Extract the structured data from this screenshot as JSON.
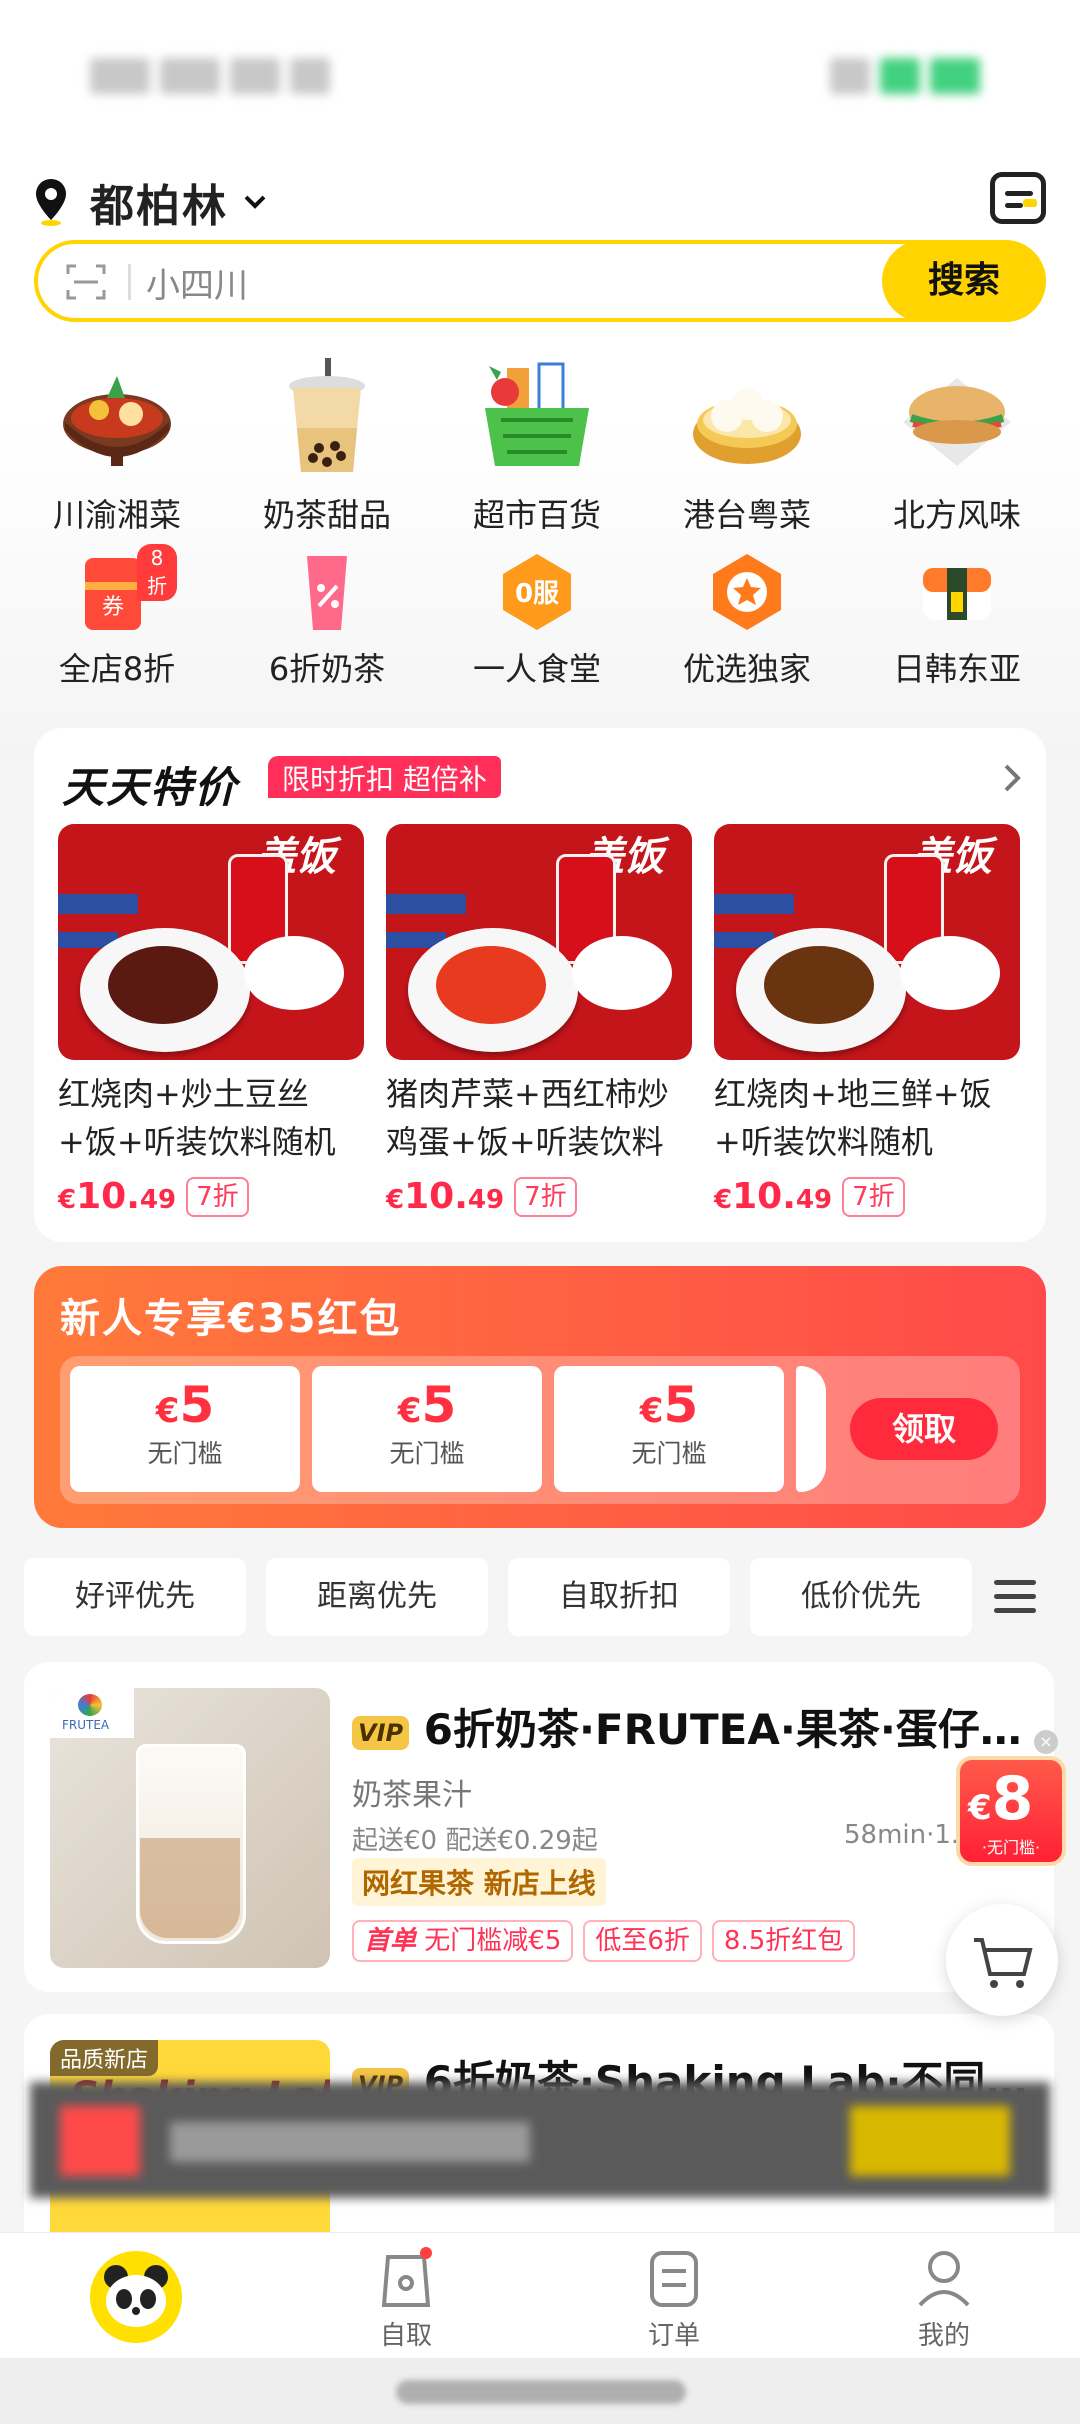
{
  "location": {
    "city": "都柏林"
  },
  "search": {
    "placeholder": "小四川",
    "button": "搜索"
  },
  "categories_row1": [
    {
      "label": "川渝湘菜",
      "icon": "hotpot-icon"
    },
    {
      "label": "奶茶甜品",
      "icon": "bubble-tea-icon"
    },
    {
      "label": "超市百货",
      "icon": "grocery-basket-icon"
    },
    {
      "label": "港台粤菜",
      "icon": "dimsum-icon"
    },
    {
      "label": "北方风味",
      "icon": "pancake-icon"
    }
  ],
  "categories_row2": [
    {
      "label": "全店8折",
      "icon": "coupon-icon",
      "badge": "8折"
    },
    {
      "label": "6折奶茶",
      "icon": "milk-tea-discount-icon"
    },
    {
      "label": "一人食堂",
      "icon": "zero-service-icon",
      "icon_text": "0服"
    },
    {
      "label": "优选独家",
      "icon": "star-hexagon-icon"
    },
    {
      "label": "日韩东亚",
      "icon": "sushi-icon"
    }
  ],
  "deals": {
    "title": "天天特价",
    "tag": "限时折扣 超倍补",
    "items": [
      {
        "name": "红烧肉+炒土豆丝+饭+听装饮料随机",
        "currency": "€",
        "price_int": "10.",
        "price_dec": "49",
        "discount": "7折",
        "banner": "盖饭",
        "food_color": "#5a1a12"
      },
      {
        "name": "猪肉芹菜+西红柿炒鸡蛋+饭+听装饮料随机",
        "currency": "€",
        "price_int": "10.",
        "price_dec": "49",
        "discount": "7折",
        "banner": "盖饭",
        "food_color": "#e83a1e"
      },
      {
        "name": "红烧肉+地三鲜+饭+听装饮料随机",
        "currency": "€",
        "price_int": "10.",
        "price_dec": "49",
        "discount": "7折",
        "banner": "盖饭",
        "food_color": "#6a3410"
      }
    ]
  },
  "redpacket": {
    "title": "新人专享€35红包",
    "coupons": [
      {
        "currency": "€",
        "value": "5",
        "cond": "无门槛"
      },
      {
        "currency": "€",
        "value": "5",
        "cond": "无门槛"
      },
      {
        "currency": "€",
        "value": "5",
        "cond": "无门槛"
      }
    ],
    "claim": "领取"
  },
  "filters": [
    "好评优先",
    "距离优先",
    "自取折扣",
    "低价优先"
  ],
  "stores": [
    {
      "vip": "VIP",
      "name": "6折奶茶·FRUTEA·果茶·蛋仔·...",
      "category": "奶茶果汁",
      "delivery": "起送€0  配送€0.29起",
      "time": "58min·1.",
      "feature": "网红果茶 新店上线",
      "tags": [
        "首单",
        "无门槛减€5",
        "低至6折",
        "8.5折红包"
      ],
      "logo": "FRUTEA"
    },
    {
      "vip": "VIP",
      "name": "6折奶茶·Shaking Lab·不同茶...",
      "badge": "品质新店",
      "image_text": "Shaking Lab"
    }
  ],
  "float_promo": {
    "currency": "€",
    "value": "8",
    "cond": "·无门槛·"
  },
  "nav": [
    {
      "label": "",
      "icon": "panda-home-icon"
    },
    {
      "label": "自取",
      "icon": "pickup-bag-icon"
    },
    {
      "label": "订单",
      "icon": "order-list-icon"
    },
    {
      "label": "我的",
      "icon": "profile-icon"
    }
  ],
  "colors": {
    "brand_yellow": "#ffd400",
    "accent_red": "#ff2a4a",
    "promo_gradient_start": "#ff7a3a",
    "promo_gradient_end": "#ff4a4a"
  }
}
